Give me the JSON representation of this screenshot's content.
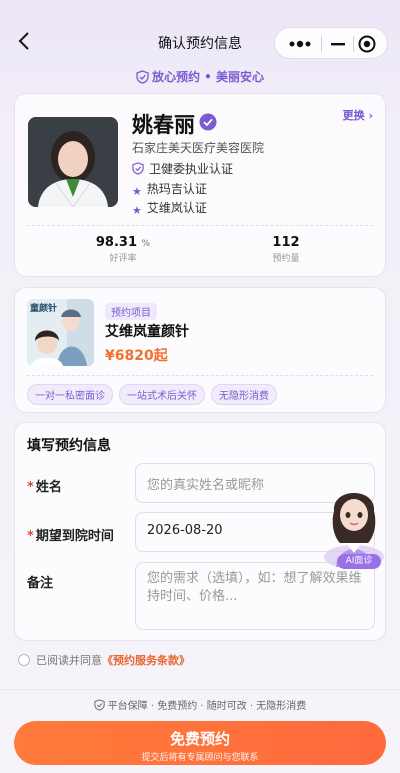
{
  "nav": {
    "title": "确认预约信息",
    "back_icon": "chevron-left-icon"
  },
  "trust_banner": {
    "text": "放心预约 • 美丽安心",
    "icon": "shield-check-icon"
  },
  "doctor": {
    "name": "姚春丽",
    "hospital": "石家庄美天医疗美容医院",
    "change_label": "更换 ›",
    "certs": [
      "卫健委执业认证",
      "热玛吉认证",
      "艾维岚认证"
    ],
    "stats": [
      {
        "value": "98.31",
        "unit": "%",
        "label": "好评率"
      },
      {
        "value": "112",
        "unit": "",
        "label": "预约量"
      }
    ]
  },
  "project": {
    "tag": "预约项目",
    "name": "艾维岚童颜针",
    "price": "¥6820起",
    "chips": [
      "一对一私密面诊",
      "一站式术后关怀",
      "无隐形消费"
    ],
    "image_text": "童颜针"
  },
  "form": {
    "title": "填写预约信息",
    "name_label": "姓名",
    "name_placeholder": "您的真实姓名或昵称",
    "date_label": "期望到院时间",
    "date_value": "2026-08-20",
    "note_label": "备注",
    "note_placeholder": "您的需求（选填），如：想了解效果维持时间、价格..."
  },
  "ai_assistant": {
    "label": "AI面诊"
  },
  "agreement": {
    "prefix": "已阅读并同意",
    "link": "《预约服务条款》"
  },
  "guarantee": {
    "text": "平台保障 · 免费预约 · 随时可改 · 无隐形消费"
  },
  "cta": {
    "main": "免费预约",
    "sub": "提交后将有专属顾问与您联系"
  },
  "colors": {
    "accent": "#7a5bd0",
    "price": "#f36f2e",
    "cta": "#ff7b3a"
  }
}
